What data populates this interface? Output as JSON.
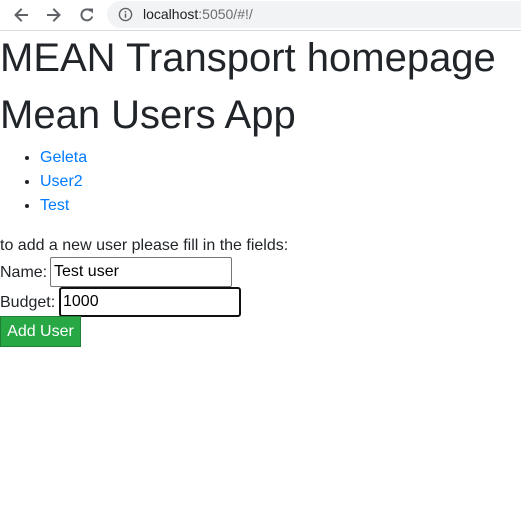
{
  "browser": {
    "url_host": "localhost",
    "url_path": ":5050/#!/",
    "icons": {
      "back": "arrow-left-icon",
      "forward": "arrow-right-icon",
      "reload": "reload-icon",
      "site_info": "info-icon"
    }
  },
  "page": {
    "title": "MEAN Transport homepage",
    "app_title": "Mean Users App",
    "users": [
      {
        "name": "Geleta"
      },
      {
        "name": "User2"
      },
      {
        "name": "Test"
      }
    ],
    "instructions": "to add a new user please fill in the fields:",
    "form": {
      "name_label": "Name:",
      "name_value": "Test user",
      "budget_label": "Budget:",
      "budget_value": "1000",
      "submit_label": "Add User"
    }
  },
  "colors": {
    "link": "#007bff",
    "button": "#28a745",
    "text": "#212529"
  }
}
